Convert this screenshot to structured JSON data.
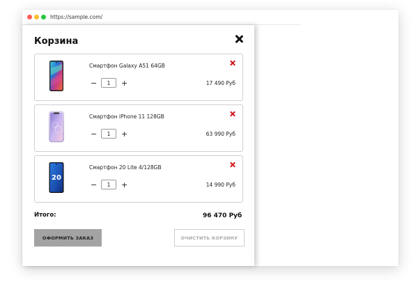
{
  "browser": {
    "url": "https://sample.com/"
  },
  "cart": {
    "title": "Корзина",
    "items": [
      {
        "name": "Смартфон Galaxy A51 64GB",
        "quantity": "1",
        "price": "17 490 Руб",
        "minus": "−",
        "plus": "+",
        "icon": "phone-galaxy-icon"
      },
      {
        "name": "Смартфон iPhone 11 128GB",
        "quantity": "1",
        "price": "63 990 Руб",
        "minus": "−",
        "plus": "+",
        "icon": "phone-iphone-icon"
      },
      {
        "name": "Смартфон 20 Lite 4/128GB",
        "quantity": "1",
        "price": "14 990 Руб",
        "minus": "−",
        "plus": "+",
        "icon": "phone-honor-icon"
      }
    ],
    "total_label": "Итого:",
    "total_value": "96 470 Руб",
    "checkout_label": "ОФОРМИТЬ ЗАКАЗ",
    "clear_label": "ОЧИСТИТЬ КОРЗИНУ"
  },
  "colors": {
    "remove_icon": "#d0121b",
    "checkout_bg": "#a3a3a3",
    "window_dot_red": "#ff5f57",
    "window_dot_yellow": "#febc2e",
    "window_dot_green": "#28c840"
  },
  "phone_screen_text": {
    "honor": "20"
  }
}
